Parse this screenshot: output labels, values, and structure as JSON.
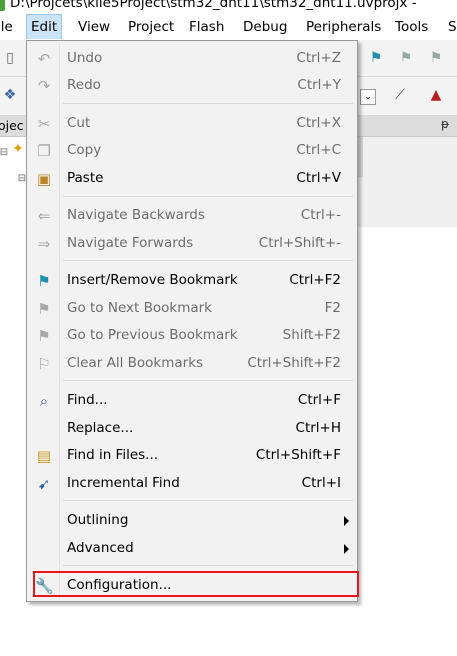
{
  "window": {
    "title": "D:\\Projcets\\kile5Project\\stm32_dht11\\stm32_dht11.uvprojx -"
  },
  "menubar": {
    "items": [
      {
        "label": "ile"
      },
      {
        "label": "Edit"
      },
      {
        "label": "View"
      },
      {
        "label": "Project"
      },
      {
        "label": "Flash"
      },
      {
        "label": "Debug"
      },
      {
        "label": "Peripherals"
      },
      {
        "label": "Tools"
      },
      {
        "label": "S"
      }
    ]
  },
  "project_pane": {
    "header_label": "ojec",
    "pin_glyph": "ᵽ"
  },
  "edit_menu": {
    "items": [
      {
        "label": "Undo",
        "shortcut": "Ctrl+Z",
        "icon": "undo-icon",
        "enabled": false
      },
      {
        "label": "Redo",
        "shortcut": "Ctrl+Y",
        "icon": "redo-icon",
        "enabled": false
      },
      {
        "label": "Cut",
        "shortcut": "Ctrl+X",
        "icon": "scissors-icon",
        "enabled": false
      },
      {
        "label": "Copy",
        "shortcut": "Ctrl+C",
        "icon": "copy-icon",
        "enabled": false
      },
      {
        "label": "Paste",
        "shortcut": "Ctrl+V",
        "icon": "paste-icon",
        "enabled": true
      },
      {
        "label": "Navigate Backwards",
        "shortcut": "Ctrl+-",
        "icon": "arrow-left-icon",
        "enabled": false
      },
      {
        "label": "Navigate Forwards",
        "shortcut": "Ctrl+Shift+-",
        "icon": "arrow-right-icon",
        "enabled": false
      },
      {
        "label": "Insert/Remove Bookmark",
        "shortcut": "Ctrl+F2",
        "icon": "bookmark-flag-icon",
        "enabled": true
      },
      {
        "label": "Go to Next Bookmark",
        "shortcut": "F2",
        "icon": "next-bookmark-icon",
        "enabled": false
      },
      {
        "label": "Go to Previous Bookmark",
        "shortcut": "Shift+F2",
        "icon": "previous-bookmark-icon",
        "enabled": false
      },
      {
        "label": "Clear All Bookmarks",
        "shortcut": "Ctrl+Shift+F2",
        "icon": "clear-bookmarks-icon",
        "enabled": false
      },
      {
        "label": "Find...",
        "shortcut": "Ctrl+F",
        "icon": "find-icon",
        "enabled": true
      },
      {
        "label": "Replace...",
        "shortcut": "Ctrl+H",
        "icon": "",
        "enabled": true
      },
      {
        "label": "Find in Files...",
        "shortcut": "Ctrl+Shift+F",
        "icon": "find-in-files-icon",
        "enabled": true
      },
      {
        "label": "Incremental Find",
        "shortcut": "Ctrl+I",
        "icon": "incremental-find-icon",
        "enabled": true
      },
      {
        "label": "Outlining",
        "shortcut": "",
        "icon": "",
        "enabled": true,
        "submenu": true
      },
      {
        "label": "Advanced",
        "shortcut": "",
        "icon": "",
        "enabled": true,
        "submenu": true
      },
      {
        "label": "Configuration...",
        "shortcut": "",
        "icon": "wrench-icon",
        "enabled": true,
        "highlighted": true
      }
    ]
  },
  "colors": {
    "menu_background": "#f2f2f2",
    "active_menu_highlight": "#cce4f7",
    "disabled_text": "#6d6d6d",
    "callout_border": "#e01a1a"
  }
}
